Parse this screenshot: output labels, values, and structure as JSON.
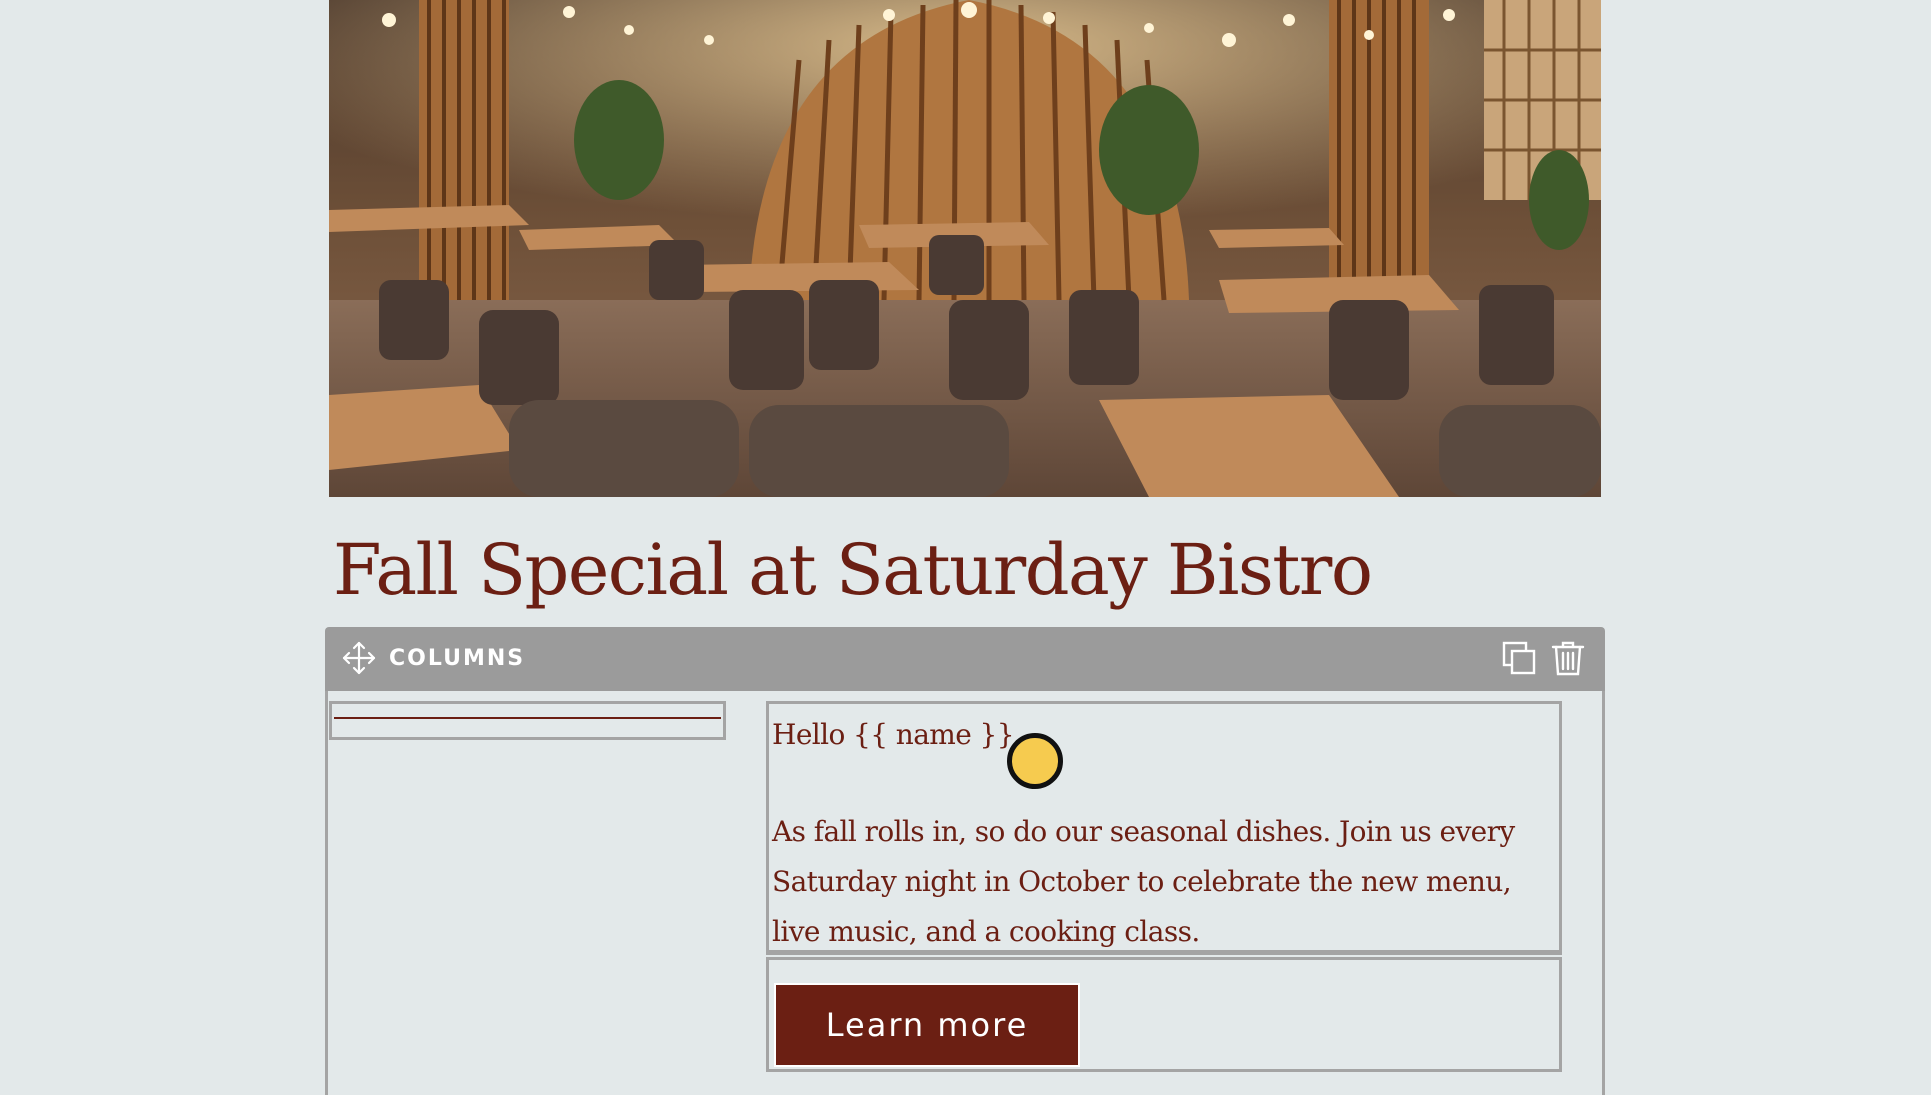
{
  "hero": {
    "image_name": "restaurant-interior-photo"
  },
  "email": {
    "title": "Fall Special at Saturday Bistro",
    "greeting": "Hello {{ name }},",
    "body": "As fall rolls in, so do our seasonal dishes. Join us every Saturday night in October to celebrate the new menu, live music, and a cooking class.",
    "button_label": "Learn more"
  },
  "block_toolbar": {
    "label": "COLUMNS",
    "icons": [
      "move-icon",
      "duplicate-icon",
      "trash-icon"
    ]
  },
  "colors": {
    "brand": "#6b1f13",
    "toolbar": "#9b9b9b",
    "background": "#e3e9ea",
    "cursor": "#f6cb4f"
  }
}
